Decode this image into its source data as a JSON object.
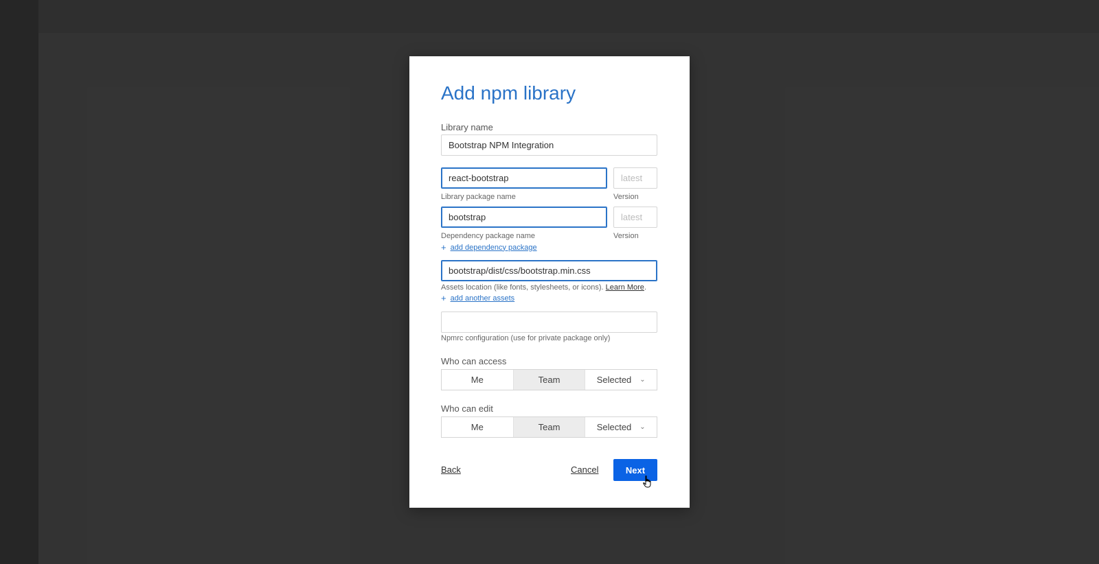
{
  "dialog": {
    "title": "Add npm library",
    "library_name": {
      "label": "Library name",
      "value": "Bootstrap NPM Integration"
    },
    "package": {
      "value": "react-bootstrap",
      "hint": "Library package name",
      "version_placeholder": "latest",
      "version_hint": "Version"
    },
    "dependency": {
      "value": "bootstrap",
      "hint": "Dependency package name",
      "version_placeholder": "latest",
      "version_hint": "Version",
      "add_link": "add dependency package"
    },
    "assets": {
      "value": "bootstrap/dist/css/bootstrap.min.css",
      "hint": "Assets location (like fonts, stylesheets, or icons).",
      "learn_more": "Learn More",
      "hint_end": ".",
      "add_link": "add another assets"
    },
    "npmrc": {
      "value": "",
      "hint": "Npmrc configuration (use for private package only)"
    },
    "access": {
      "label": "Who can access",
      "options": [
        "Me",
        "Team",
        "Selected"
      ],
      "selected": "Team"
    },
    "edit": {
      "label": "Who can edit",
      "options": [
        "Me",
        "Team",
        "Selected"
      ],
      "selected": "Team"
    },
    "footer": {
      "back": "Back",
      "cancel": "Cancel",
      "next": "Next"
    }
  },
  "colors": {
    "accent": "#2a73c7",
    "primary_button": "#0b63e5"
  },
  "icons": {
    "plus": "plus-icon",
    "chevron": "chevron-down-icon",
    "cursor": "hand-pointer-icon"
  }
}
